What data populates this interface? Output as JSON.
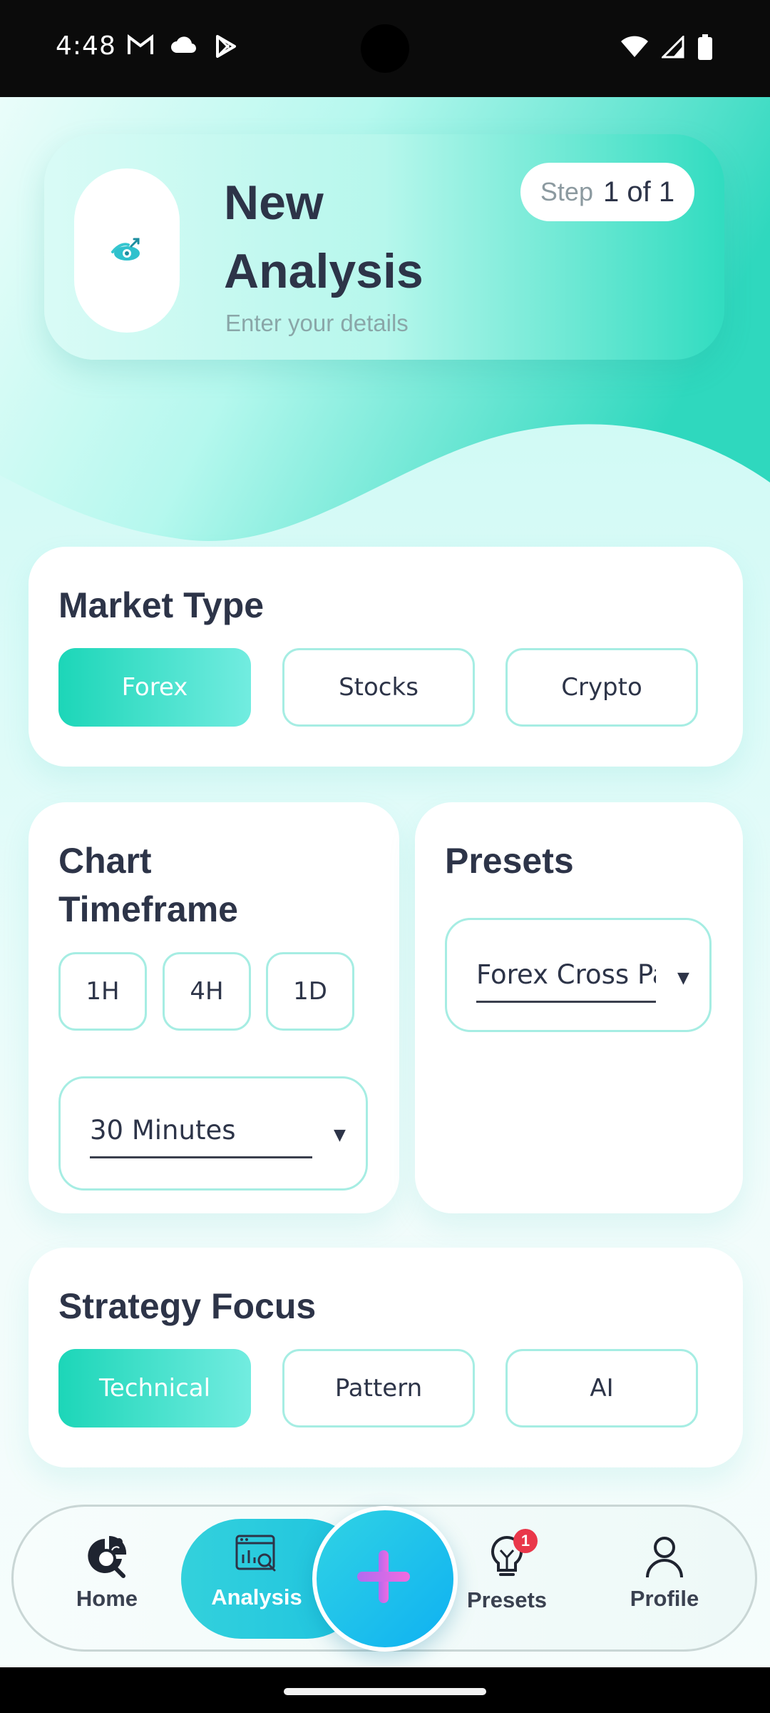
{
  "status_bar": {
    "time": "4:48",
    "left_icons": [
      "gmail-icon",
      "cloud-icon",
      "play-store-icon"
    ],
    "right_icons": [
      "wifi-icon",
      "signal-icon",
      "battery-icon"
    ]
  },
  "header": {
    "title": "New Analysis",
    "subtitle": "Enter your details",
    "step_label": "Step",
    "step_value": "1 of 1",
    "icon": "eye-analysis-icon"
  },
  "market_type": {
    "title": "Market Type",
    "options": [
      "Forex",
      "Stocks",
      "Crypto"
    ],
    "selected": "Forex"
  },
  "chart_timeframe": {
    "title": "Chart Timeframe",
    "options": [
      "1H",
      "4H",
      "1D"
    ],
    "dropdown_value": "30 Minutes"
  },
  "presets": {
    "title": "Presets",
    "dropdown_value": "Forex Cross Pa"
  },
  "strategy_focus": {
    "title": "Strategy Focus",
    "options": [
      "Technical",
      "Pattern",
      "AI"
    ],
    "selected": "Technical"
  },
  "bottom_nav": {
    "items": [
      {
        "label": "Home",
        "icon": "home-analytics-icon"
      },
      {
        "label": "Analysis",
        "icon": "analysis-icon",
        "active": true
      },
      {
        "label": "Presets",
        "icon": "lightbulb-icon",
        "badge": "1"
      },
      {
        "label": "Profile",
        "icon": "profile-icon"
      }
    ],
    "fab_icon": "plus-icon"
  },
  "colors": {
    "accent": "#1cd6b8",
    "text": "#2d3448",
    "chip_border": "#a6ede3",
    "badge": "#e9374a"
  }
}
